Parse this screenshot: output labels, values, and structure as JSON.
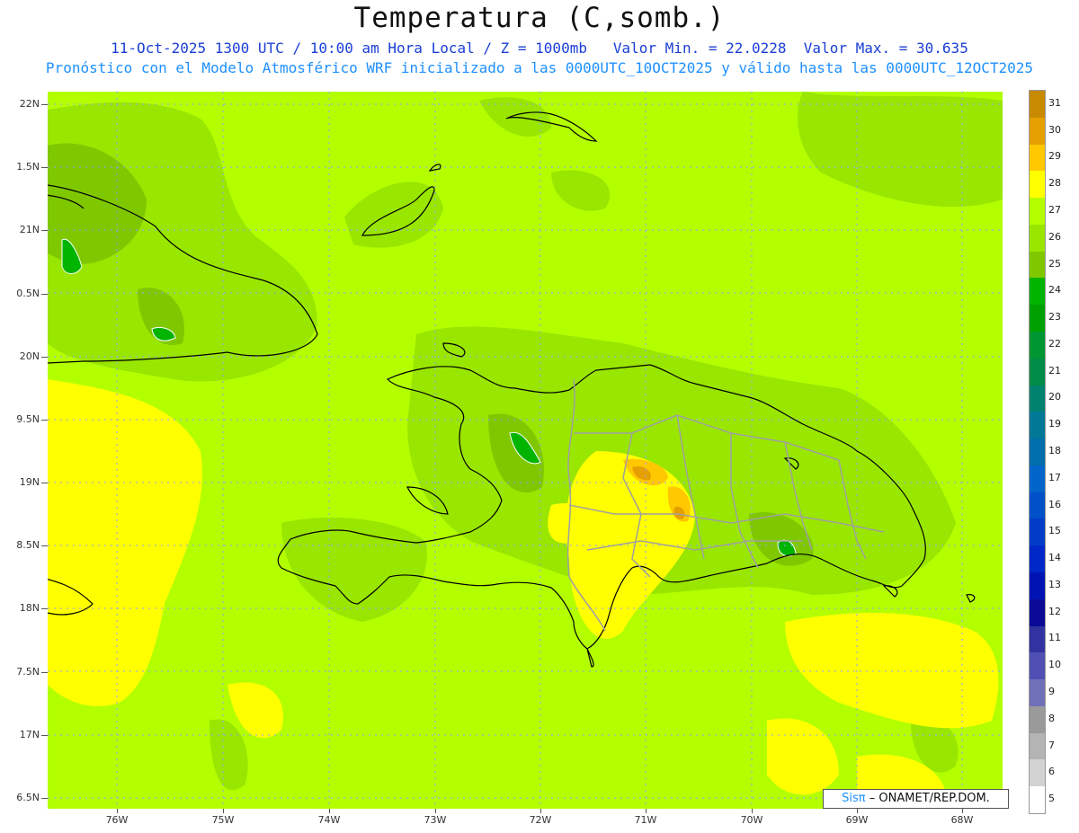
{
  "title": "Temperatura (C,somb.)",
  "subtitle1": {
    "run": "11-Oct-2025 1300 UTC / 10:00 am Hora Local / Z = 1000mb",
    "min": "Valor Min. = 22.0228",
    "max": "Valor Max. = 30.635"
  },
  "subtitle2": "Pronóstico con el Modelo Atmosférico WRF inicializado a las 0000UTC_10OCT2025 y válido hasta las  0000UTC_12OCT2025",
  "lat_labels": [
    "22N",
    "1.5N",
    "21N",
    "0.5N",
    "20N",
    "9.5N",
    "19N",
    "8.5N",
    "18N",
    "7.5N",
    "17N",
    "6.5N"
  ],
  "lon_labels": [
    "76W",
    "75W",
    "74W",
    "73W",
    "72W",
    "71W",
    "70W",
    "69W",
    "68W"
  ],
  "legend": {
    "labels": [
      "31",
      "30",
      "29",
      "28",
      "27",
      "26",
      "25",
      "24",
      "23",
      "22",
      "21",
      "20",
      "19",
      "18",
      "17",
      "16",
      "15",
      "14",
      "13",
      "12",
      "11",
      "10",
      "9",
      "8",
      "7",
      "6",
      "5"
    ],
    "colors": [
      "#c78a00",
      "#e59f00",
      "#ffc800",
      "#ffff00",
      "#b3ff00",
      "#99e600",
      "#7fc800",
      "#00b400",
      "#00a000",
      "#009632",
      "#008c46",
      "#00826e",
      "#007896",
      "#006eaa",
      "#0064c8",
      "#0050c8",
      "#003cc8",
      "#0028c8",
      "#0014b4",
      "#0a0a96",
      "#3232a0",
      "#5050b4",
      "#7070b9",
      "#9a9a9a",
      "#b4b4b4",
      "#d2d2d2",
      "#ffffff"
    ]
  },
  "credit": {
    "sis": "Sisπ",
    "org": "– ONAMET/REP.DOM."
  }
}
